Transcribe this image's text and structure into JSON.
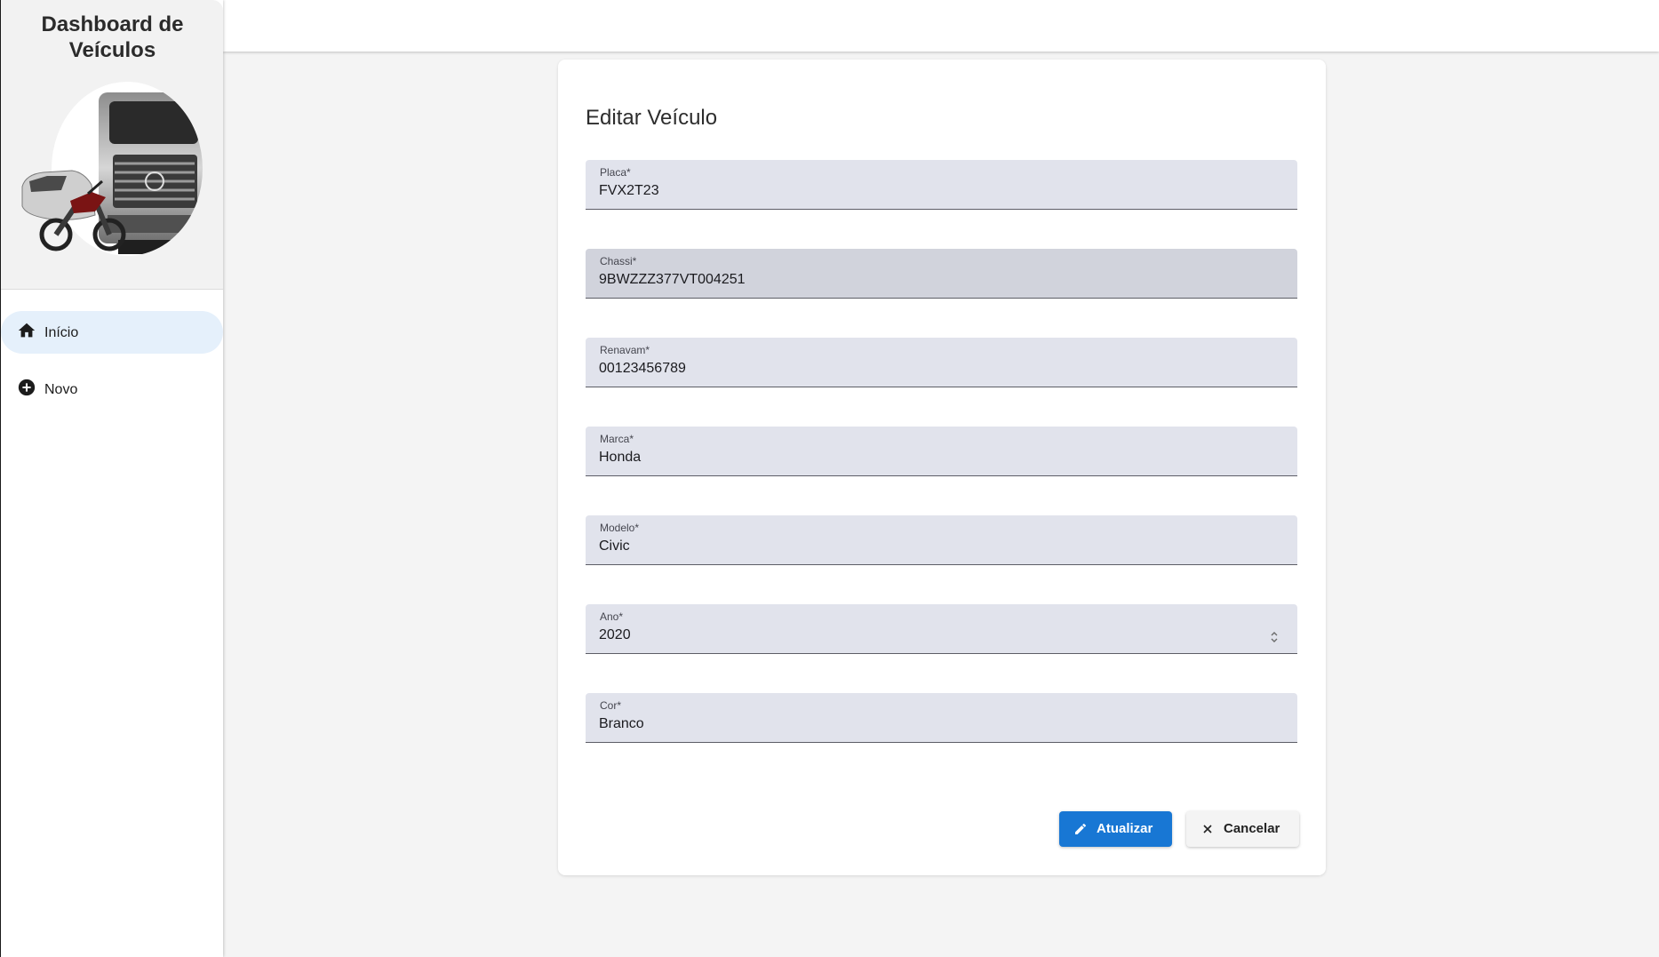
{
  "sidebar": {
    "title": "Dashboard de Veículos",
    "logo_icon": "vehicles-logo",
    "items": [
      {
        "label": "Início",
        "icon": "home-icon",
        "active": true
      },
      {
        "label": "Novo",
        "icon": "add-circle-icon",
        "active": false
      }
    ]
  },
  "form": {
    "title": "Editar Veículo",
    "fields": [
      {
        "label": "Placa*",
        "value": "FVX2T23"
      },
      {
        "label": "Chassi*",
        "value": "9BWZZZ377VT004251"
      },
      {
        "label": "Renavam*",
        "value": "00123456789"
      },
      {
        "label": "Marca*",
        "value": "Honda"
      },
      {
        "label": "Modelo*",
        "value": "Civic"
      },
      {
        "label": "Ano*",
        "value": "2020"
      },
      {
        "label": "Cor*",
        "value": "Branco"
      }
    ],
    "submit_label": "Atualizar",
    "cancel_label": "Cancelar"
  },
  "colors": {
    "primary": "#1877d4",
    "field_bg": "#e1e3ec",
    "nav_active": "#e5f0fb"
  }
}
